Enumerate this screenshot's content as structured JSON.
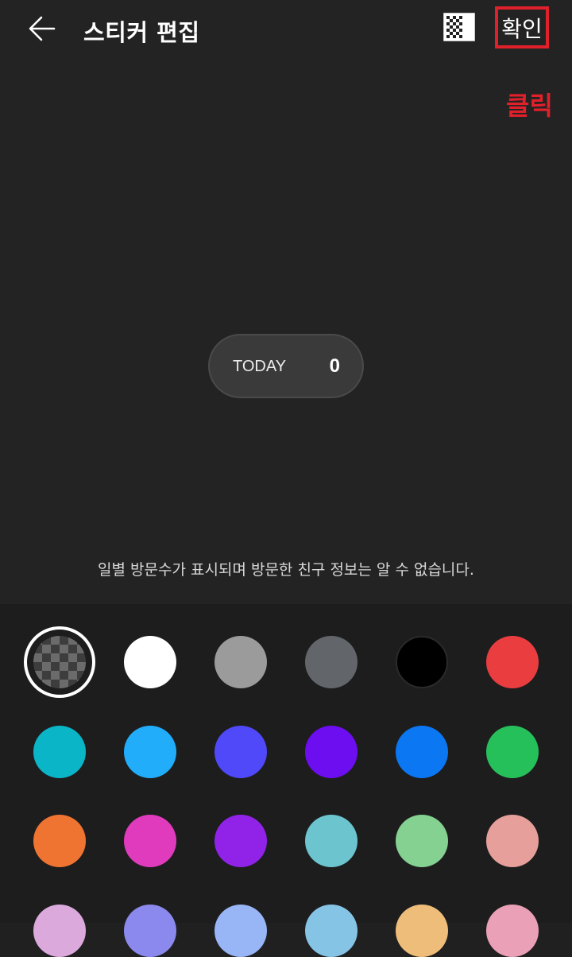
{
  "header": {
    "title": "스티커 편집",
    "back_icon": "back-arrow-icon",
    "bg_toggle_icon": "transparency-toggle-icon",
    "confirm_label": "확인"
  },
  "annotation": {
    "text": "클릭",
    "color": "#e0202a"
  },
  "sticker": {
    "label": "TODAY",
    "count": "0"
  },
  "notice": "일별 방문수가 표시되며 방문한 친구 정보는 알 수 없습니다.",
  "palette": {
    "selected_index": 0,
    "rows": [
      [
        "transparent",
        "#ffffff",
        "#9b9b9b",
        "#62666b",
        "#000000",
        "#ea3d40"
      ],
      [
        "#0ab5c8",
        "#22adfb",
        "#5049fa",
        "#6c0ef0",
        "#0c77f2",
        "#26c05b"
      ],
      [
        "#f07431",
        "#e13bbd",
        "#9123e9",
        "#6cc4cf",
        "#84d191",
        "#e69f9a"
      ],
      [
        "#dca9dd",
        "#8b89ed",
        "#98b5f5",
        "#86c4e6",
        "#eebd7a",
        "#eaa0b6"
      ]
    ]
  }
}
